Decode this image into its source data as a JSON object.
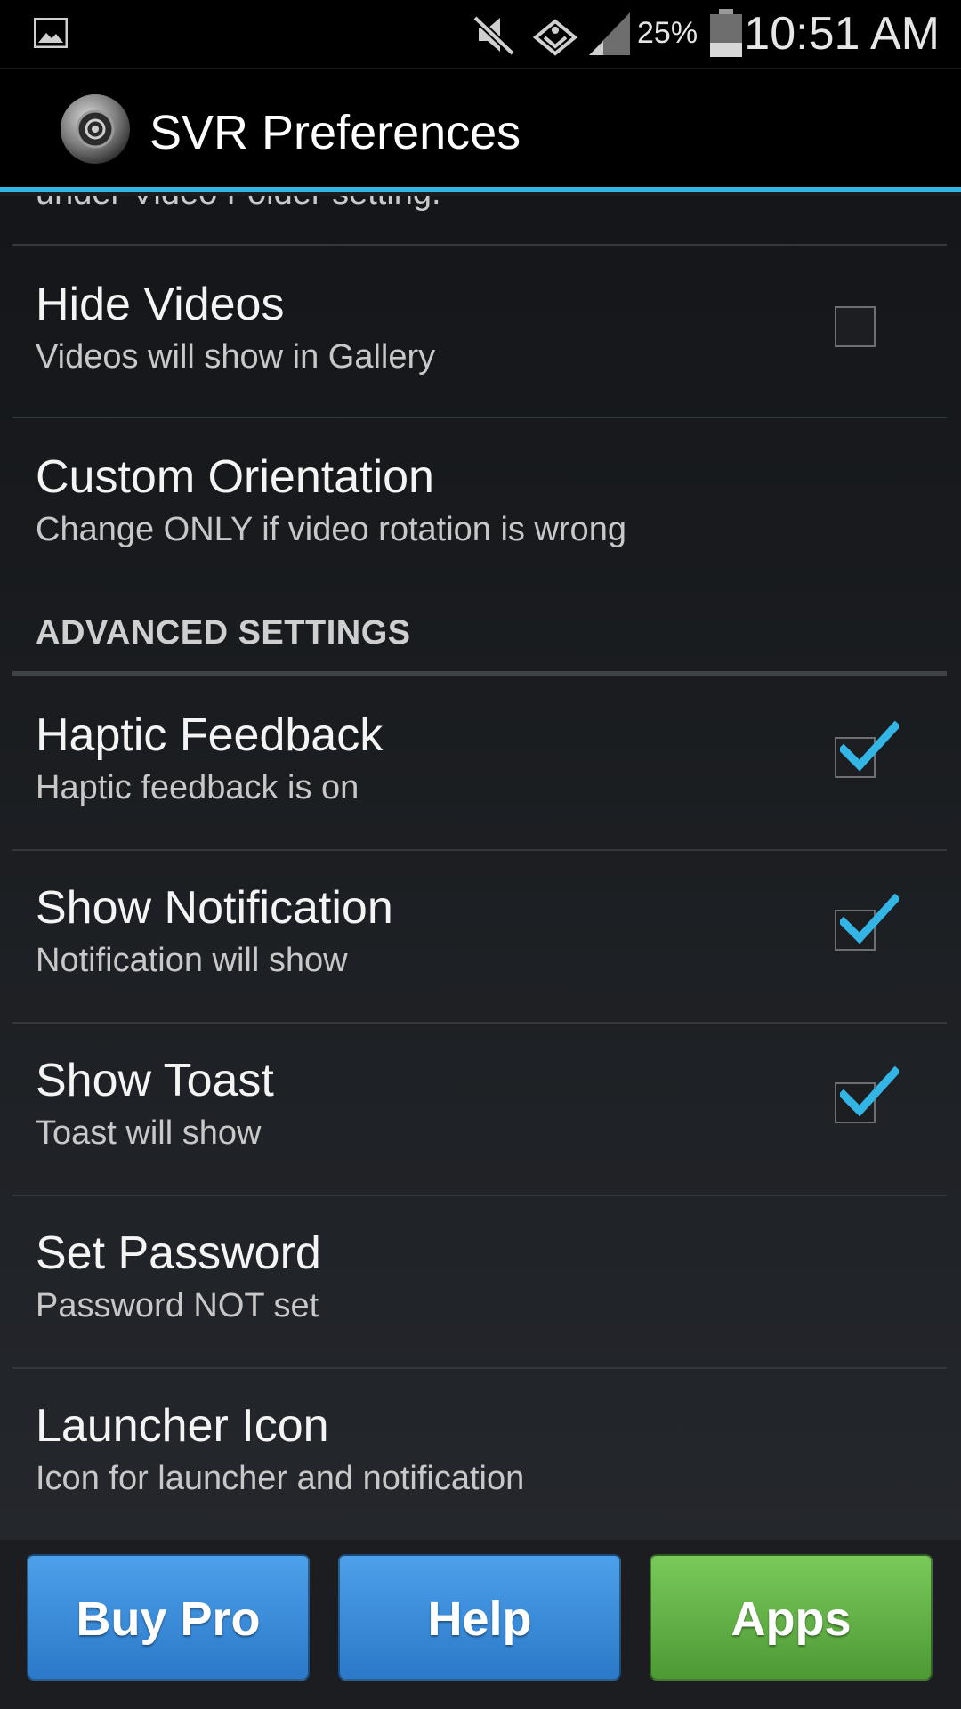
{
  "status_bar": {
    "battery_percent": "25%",
    "time": "10:51 AM",
    "icons": [
      "image-icon",
      "mute-icon",
      "sync-icon",
      "signal-icon",
      "battery-icon"
    ]
  },
  "action_bar": {
    "title": "SVR Preferences",
    "icon": "camera-lens-icon",
    "accent_color": "#33b5e5"
  },
  "list": {
    "clipped_text": "under Video Folder setting.",
    "section_header": "ADVANCED SETTINGS",
    "items": [
      {
        "title": "Hide Videos",
        "summary": "Videos will show in Gallery",
        "checked": false
      },
      {
        "title": "Custom Orientation",
        "summary": "Change ONLY if video rotation is wrong"
      },
      {
        "title": "Haptic Feedback",
        "summary": "Haptic feedback is on",
        "checked": true
      },
      {
        "title": "Show Notification",
        "summary": "Notification will show",
        "checked": true
      },
      {
        "title": "Show Toast",
        "summary": "Toast will show",
        "checked": true
      },
      {
        "title": "Set Password",
        "summary": "Password NOT set"
      },
      {
        "title": "Launcher Icon",
        "summary": "Icon for launcher and notification"
      }
    ]
  },
  "buttons": {
    "buy_pro": "Buy Pro",
    "help": "Help",
    "apps": "Apps"
  },
  "colors": {
    "blue_button": "#3a8ad9",
    "green_button": "#5fb043",
    "check_color": "#33b5e5"
  }
}
